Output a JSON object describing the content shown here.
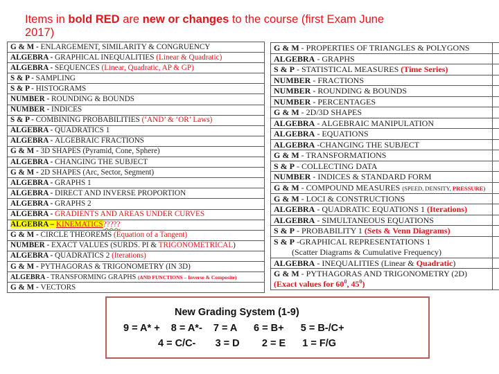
{
  "header": {
    "t1": "Items in ",
    "t2": "bold RED",
    "t3": " are ",
    "t4": "new or changes",
    "t5": " to the course (first Exam June 2017)"
  },
  "left_table": [
    {
      "subject": "G & M - ",
      "topic": "ENLARGEMENT, SIMILARITY & CONGRUENCY",
      "extra": ""
    },
    {
      "subject": "ALGEBRA - ",
      "topic": "GRAPHICAL INEQUALITIES ",
      "extra": "(Linear & Quadratic)"
    },
    {
      "subject": "ALGEBRA - ",
      "topic": "SEQUENCES ",
      "extra": "(Linear, Quadratic, AP & GP)"
    },
    {
      "subject": "S & P - ",
      "topic": "SAMPLING",
      "extra": ""
    },
    {
      "subject": "S & P - ",
      "topic": "HISTOGRAMS",
      "extra": ""
    },
    {
      "subject": "NUMBER - ",
      "topic": "ROUNDING & BOUNDS",
      "extra": ""
    },
    {
      "subject": "NUMBER - ",
      "topic": "INDICES",
      "extra": ""
    },
    {
      "subject": "S & P - ",
      "topic": "COMBINING PROBABILITIES ",
      "extra": "(‘AND’ & ‘OR’ Laws)"
    },
    {
      "subject": "ALGEBRA - ",
      "topic": "QUADRATICS 1",
      "extra": ""
    },
    {
      "subject": "ALGEBRA - ",
      "topic": "ALGEBRAIC FRACTIONS",
      "extra": ""
    },
    {
      "subject": "G & M - ",
      "topic": "3D SHAPES (Pyramid, Cone, Sphere)",
      "extra": ""
    },
    {
      "subject": "ALGEBRA - ",
      "topic": "CHANGING THE SUBJECT",
      "extra": ""
    },
    {
      "subject": "G & M - ",
      "topic": "2D SHAPES (Arc, Sector, Segment)",
      "extra": ""
    },
    {
      "subject": "ALGEBRA - ",
      "topic": "GRAPHS 1",
      "extra": ""
    },
    {
      "subject": "ALGEBRA - ",
      "topic": "DIRECT AND INVERSE PROPORTION",
      "extra": ""
    },
    {
      "subject": "ALGEBRA - ",
      "topic": "GRAPHS 2",
      "extra": ""
    },
    {
      "subject": "ALGEBRA - ",
      "topic": "",
      "extra": "GRADIENTS AND AREAS UNDER CURVES"
    },
    {
      "subject": "ALGEBRA – ",
      "topic": "KINEMATICS",
      "extra": "?????"
    },
    {
      "subject": "G & M - ",
      "topic": "CIRCLE THEOREMS  ",
      "extra": "(Equation of a Tangent)"
    },
    {
      "subject": "NUMBER - ",
      "topic": "EXACT VALUES (SURDS. PI & ",
      "extra": "TRIGONOMETRICAL",
      "tail": ")"
    },
    {
      "subject": "ALGEBRA - ",
      "topic": "QUADRATICS 2 ",
      "extra": "(Iterations)"
    },
    {
      "subject": "G & M - ",
      "topic": "PYTHAGORAS & TRIGONOMETRY (IN 3D)",
      "extra": ""
    },
    {
      "subject": "ALGEBRA ",
      "topic": "- TRANSFORMING GRAPHS ",
      "extra": "(AND FUNCTIONS  – Inverse & Composite)"
    },
    {
      "subject": "G & M - ",
      "topic": "VECTORS",
      "extra": ""
    }
  ],
  "right_table": [
    {
      "subject": "G & M",
      "topic": " - PROPERTIES OF TRIANGLES & POLYGONS",
      "extra": ""
    },
    {
      "subject": "ALGEBRA",
      "topic": " - GRAPHS",
      "extra": ""
    },
    {
      "subject": "S & P",
      "topic": " - STATISTICAL MEASURES ",
      "extra": "(Time Series)"
    },
    {
      "subject": "NUMBER",
      "topic": " - FRACTIONS",
      "extra": ""
    },
    {
      "subject": "NUMBER",
      "topic": " - ROUNDING & BOUNDS",
      "extra": ""
    },
    {
      "subject": "NUMBER",
      "topic": " - PERCENTAGES",
      "extra": ""
    },
    {
      "subject": "G & M",
      "topic": " - 2D/3D SHAPES",
      "extra": ""
    },
    {
      "subject": "ALGEBRA",
      "topic": " - ALGEBRAIC MANIPULATION",
      "extra": ""
    },
    {
      "subject": "ALGEBRA",
      "topic": " - EQUATIONS",
      "extra": ""
    },
    {
      "subject": "ALGEBRA",
      "topic": " -CHANGING THE SUBJECT",
      "extra": ""
    },
    {
      "subject": "G & M",
      "topic": " - TRANSFORMATIONS",
      "extra": ""
    },
    {
      "subject": "S & P",
      "topic": " - COLLECTING DATA",
      "extra": ""
    },
    {
      "subject": "NUMBER",
      "topic": " - INDICES & STANDARD FORM",
      "extra": ""
    },
    {
      "subject": "G & M",
      "topic": " - COMPOUND MEASURES  ",
      "small": "(SPEED, DENSITY, ",
      "extra": "PRESSURE",
      "tail": ")"
    },
    {
      "subject": "G & M",
      "topic": " - LOCI & CONSTRUCTIONS",
      "extra": ""
    },
    {
      "subject": "ALGEBRA",
      "topic": " - QUADRATIC EQUATIONS 1 ",
      "extra": "(Iterations)"
    },
    {
      "subject": "ALGEBRA",
      "topic": " - SIMULTANEOUS EQUATIONS",
      "extra": ""
    },
    {
      "subject": "S & P",
      "topic": " - PROBABILITY 1 ",
      "extra": "(Sets & Venn Diagrams)"
    },
    {
      "subject": "S & P",
      "topic": " -GRAPHICAL REPRESENTATIONS 1",
      "line2": "(Scatter Diagrams & Cumulative Frequency)"
    },
    {
      "subject": "ALGEBRA",
      "topic": " - INEQUALITIES  (Linear & ",
      "extra": "Quadratic",
      "tail": ")"
    },
    {
      "subject": "G & M",
      "topic": " - PYTHAGORAS AND TRIGONOMETRY (2D)",
      "line2_red_a": "(Exact values for 60",
      "sup1": "0",
      "line2_red_b": ", 45",
      "sup2": "0",
      "line2_red_c": ")"
    }
  ],
  "grading": {
    "title": "New Grading System (1-9)",
    "row1": "9 = A* +    8 = A*-    7 = A      6 = B+      5 = B-/C+",
    "row2": "4 = C/C-       3 = D        2 = E      1 = F/G"
  }
}
